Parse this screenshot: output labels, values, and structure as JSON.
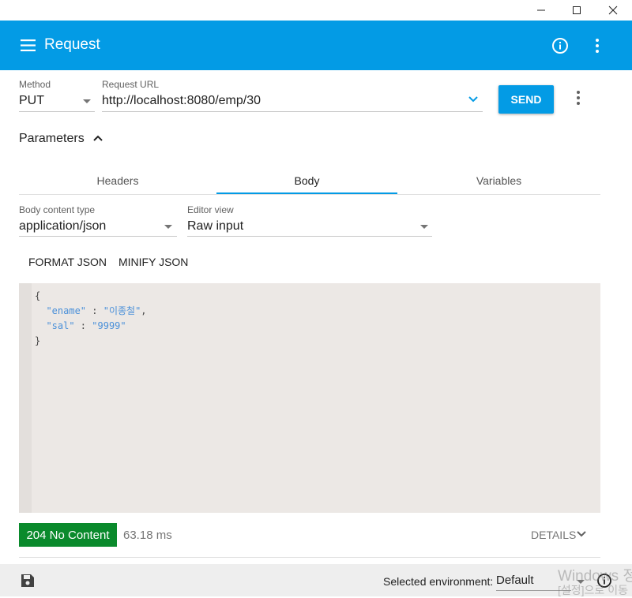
{
  "window": {
    "controls": [
      "minimize",
      "maximize",
      "close"
    ]
  },
  "appbar": {
    "title": "Request",
    "bg": "#039be5"
  },
  "request": {
    "method_label": "Method",
    "method_value": "PUT",
    "url_label": "Request URL",
    "url_value": "http://localhost:8080/emp/30",
    "send_label": "SEND"
  },
  "parameters": {
    "label": "Parameters",
    "tabs": [
      {
        "label": "Headers",
        "active": false
      },
      {
        "label": "Body",
        "active": true
      },
      {
        "label": "Variables",
        "active": false
      }
    ]
  },
  "body": {
    "content_type_label": "Body content type",
    "content_type_value": "application/json",
    "editor_view_label": "Editor view",
    "editor_view_value": "Raw input",
    "format_label": "FORMAT JSON",
    "minify_label": "MINIFY JSON",
    "code_lines": {
      "open": "{",
      "line1_key": "\"ename\"",
      "line1_sep": " : ",
      "line1_val": "\"이종철\"",
      "line1_end": ",",
      "line2_key": "\"sal\"",
      "line2_sep": " : ",
      "line2_val": "\"9999\"",
      "close": "}"
    }
  },
  "response": {
    "status": "204 No Content",
    "status_color": "#0a8a2c",
    "time": "63.18 ms",
    "details_label": "DETAILS"
  },
  "footer": {
    "env_label": "Selected environment:",
    "env_value": "Default"
  },
  "watermark": {
    "line1": "Windows 정",
    "line2": "[설정]으로 이동"
  }
}
